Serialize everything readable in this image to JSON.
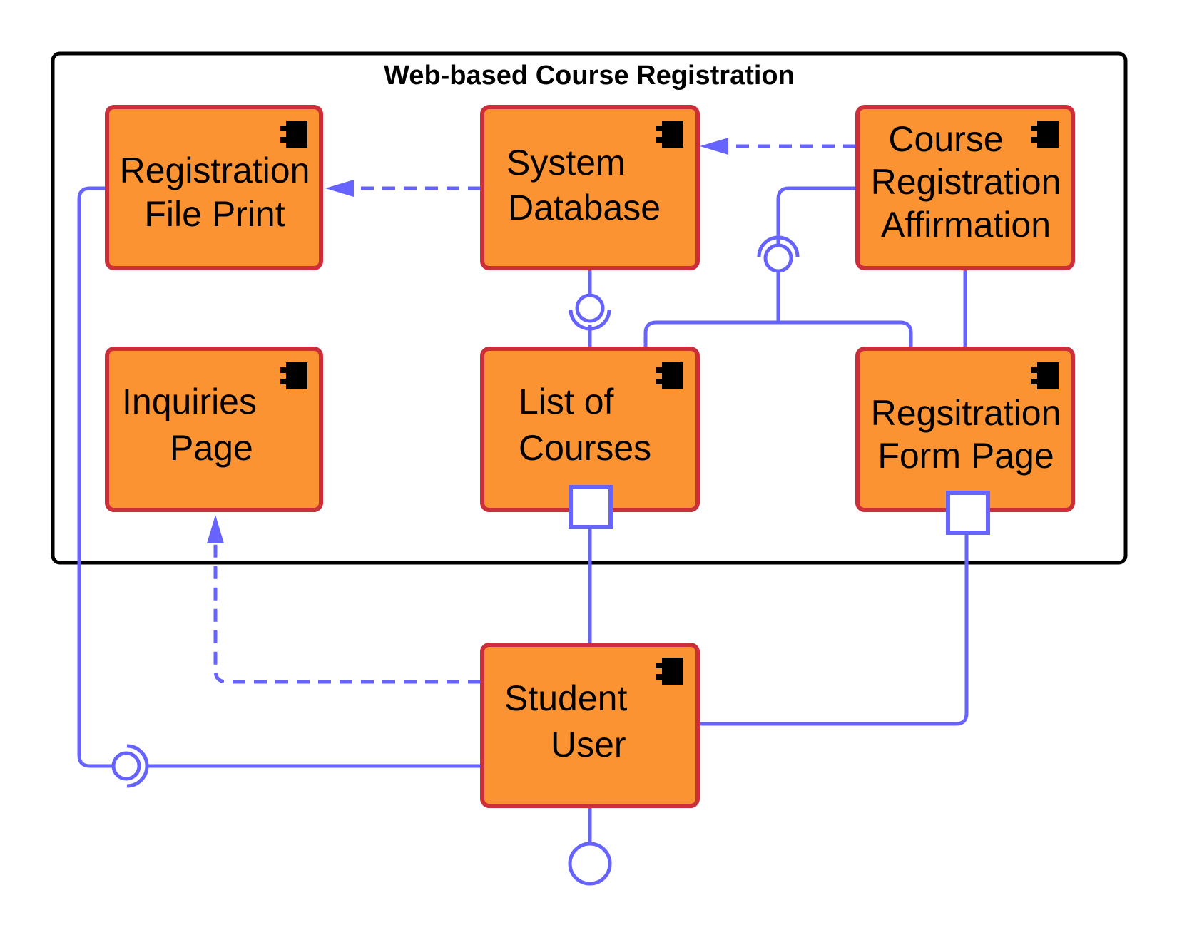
{
  "diagram": {
    "type": "UML component diagram",
    "frame_title": "Web-based Course Registration",
    "colors": {
      "component_fill": "#fb9333",
      "component_border": "#cc2f3a",
      "connector": "#6663ff",
      "frame": "#000000"
    },
    "components": {
      "registration_file_print": {
        "lines": [
          "Registration",
          "File Print"
        ]
      },
      "system_database": {
        "lines": [
          "System",
          "Database"
        ]
      },
      "course_registration_affirmation": {
        "lines": [
          "Course",
          "Registration",
          "Affirmation"
        ]
      },
      "inquiries_page": {
        "lines": [
          "Inquiries",
          "Page"
        ]
      },
      "list_of_courses": {
        "lines": [
          "List of",
          "Courses"
        ]
      },
      "registration_form_page": {
        "lines": [
          "Regsitration",
          "Form Page"
        ]
      },
      "student_user": {
        "lines": [
          "Student",
          "User"
        ]
      }
    },
    "relationships": [
      {
        "from": "System Database",
        "to": "Registration File Print",
        "kind": "dependency"
      },
      {
        "from": "Course Registration Affirmation",
        "to": "System Database",
        "kind": "dependency"
      },
      {
        "from": "Student User",
        "to": "Inquiries Page",
        "kind": "dependency"
      },
      {
        "from": "System Database",
        "to": "List of Courses",
        "kind": "assembly"
      },
      {
        "from": "Course Registration Affirmation",
        "to": "List of Courses / Regsitration Form Page",
        "kind": "assembly"
      },
      {
        "from": "Course Registration Affirmation",
        "to": "Regsitration Form Page",
        "kind": "association"
      },
      {
        "from": "List of Courses",
        "to": "Student User",
        "kind": "port connection"
      },
      {
        "from": "Regsitration Form Page",
        "to": "Student User",
        "kind": "port connection"
      },
      {
        "from": "Student User",
        "to": "Registration File Print",
        "kind": "assembly"
      },
      {
        "from": "Student User",
        "to": "",
        "kind": "provided interface"
      }
    ]
  }
}
